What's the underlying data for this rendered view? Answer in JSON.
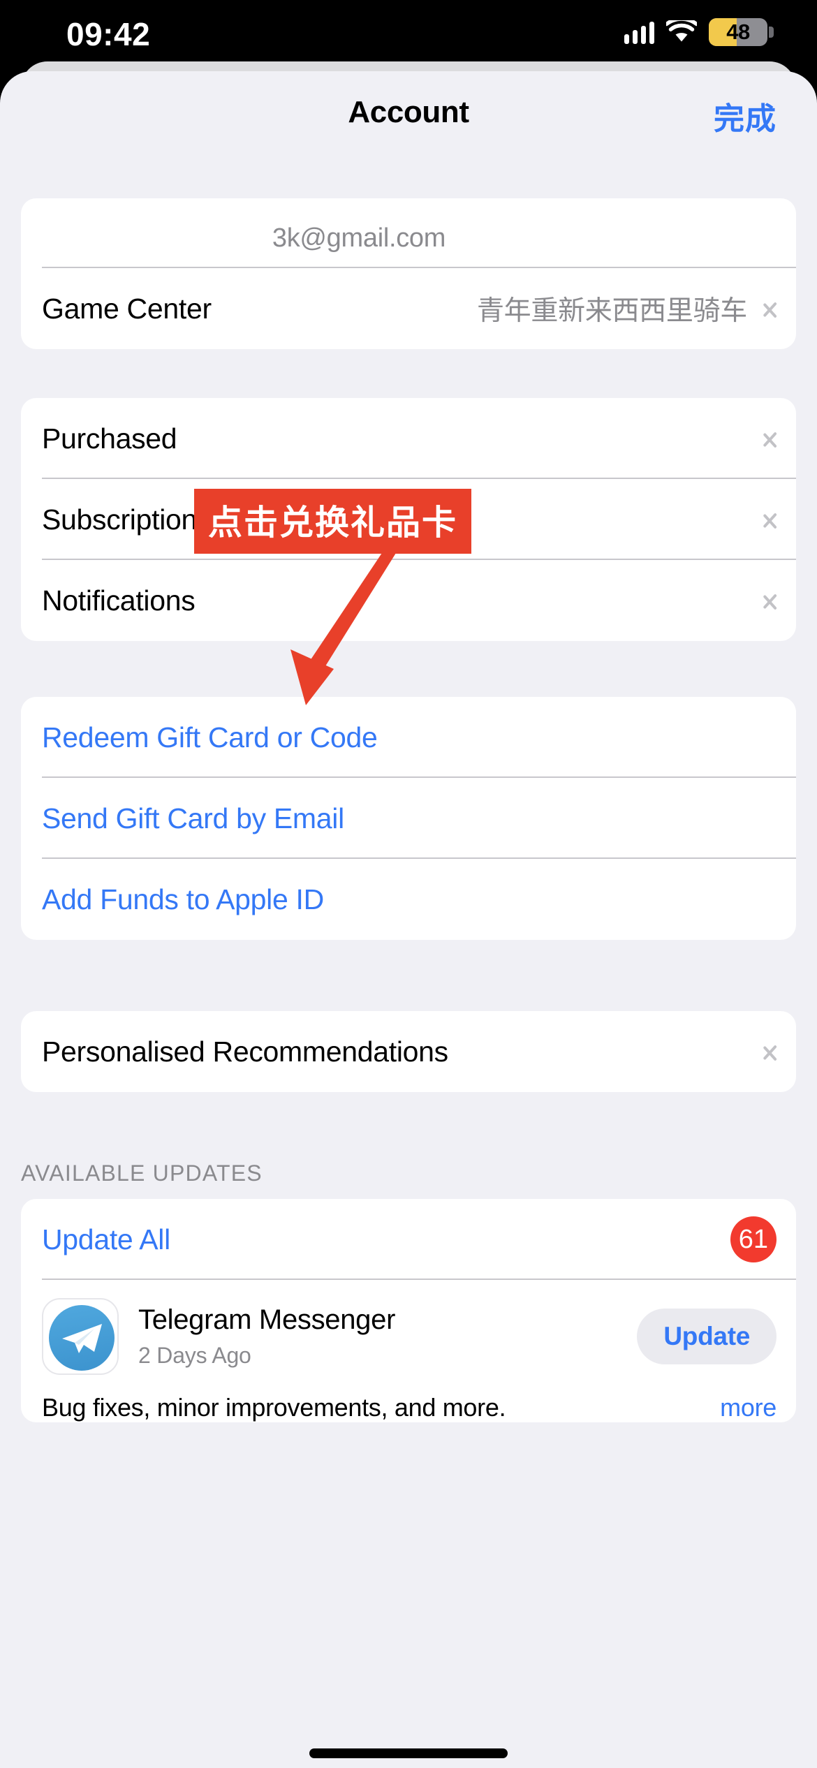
{
  "status_bar": {
    "time": "09:42",
    "battery_percent": "48",
    "battery_level": 48,
    "battery_low_power_color": "#F2C94C",
    "cellular_icon": "cellular-bars-icon",
    "wifi_icon": "wifi-icon"
  },
  "nav": {
    "title": "Account",
    "done_label": "完成",
    "done_color": "#3478F6"
  },
  "account_card": {
    "email": "3k@gmail.com",
    "game_center_label": "Game Center",
    "game_center_value": "青年重新来西西里骑车"
  },
  "settings_card": {
    "items": [
      {
        "label": "Purchased"
      },
      {
        "label": "Subscriptions"
      },
      {
        "label": "Notifications"
      }
    ]
  },
  "giftcard_card": {
    "items": [
      {
        "label": "Redeem Gift Card or Code"
      },
      {
        "label": "Send Gift Card by Email"
      },
      {
        "label": "Add Funds to Apple ID"
      }
    ]
  },
  "recommendations_card": {
    "label": "Personalised Recommendations"
  },
  "updates_section": {
    "header": "AVAILABLE UPDATES",
    "update_all_label": "Update All",
    "update_all_badge": "61",
    "badge_color": "#F23A2E",
    "app": {
      "name": "Telegram Messenger",
      "date": "2 Days Ago",
      "button_label": "Update",
      "description": "Bug fixes, minor improvements, and more.",
      "more_label": "more",
      "icon": "telegram-icon"
    }
  },
  "annotation": {
    "banner_text": "点击兑换礼品卡",
    "banner_color": "#E8402A",
    "arrow_color": "#E8402A",
    "arrow_icon": "arrow-pointing-down-left-icon"
  }
}
